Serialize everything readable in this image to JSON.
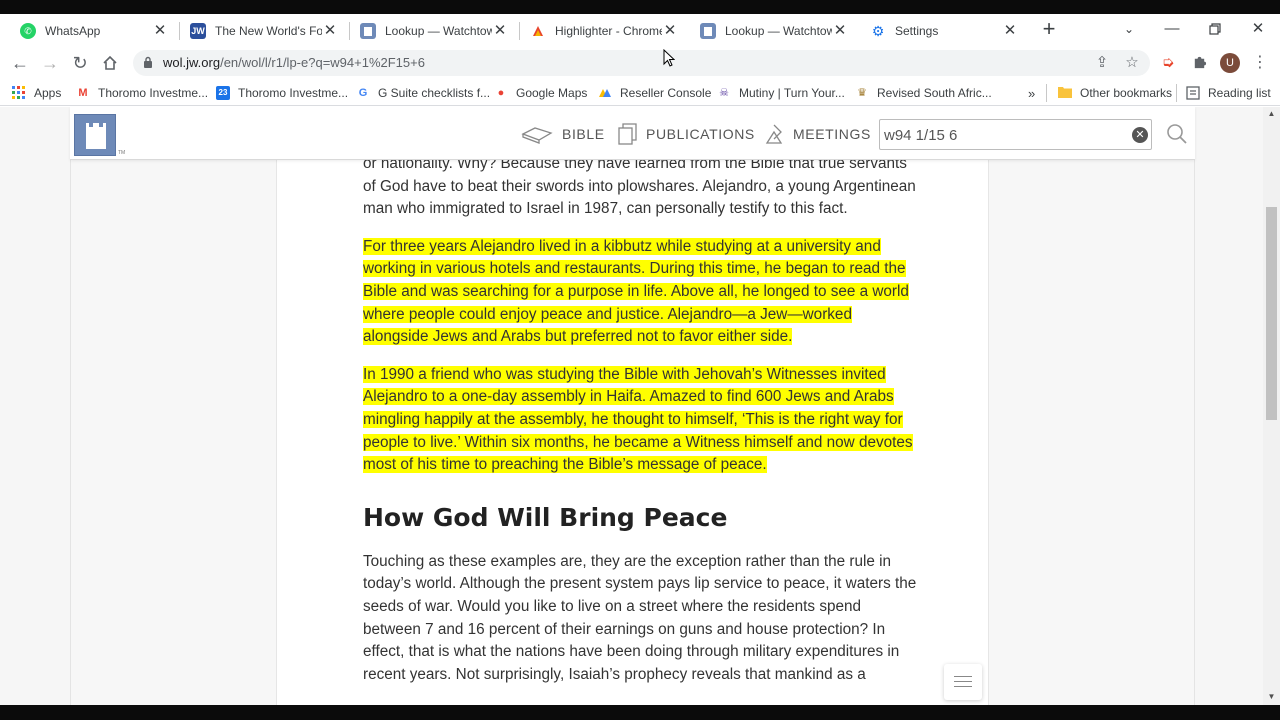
{
  "browser": {
    "tabs": [
      {
        "title": "WhatsApp",
        "favicon": "whatsapp-icon",
        "color": "#25d366"
      },
      {
        "title": "The New World's Foundation",
        "favicon": "jw-icon",
        "color": "#2b4f9c"
      },
      {
        "title": "Lookup — Watchtower",
        "favicon": "watchtower-icon",
        "color": "#6e8ab8"
      },
      {
        "title": "Highlighter - Chrome",
        "favicon": "highlighter-icon",
        "color": "#e8452c"
      },
      {
        "title": "Lookup — Watchtower",
        "favicon": "watchtower-icon",
        "color": "#6e8ab8"
      },
      {
        "title": "Settings",
        "favicon": "gear-icon",
        "color": "#1a73e8"
      }
    ],
    "active_tab": 4,
    "url_host": "wol.jw.org",
    "url_rest": "/en/wol/l/r1/lp-e?q=w94+1%2F15+6",
    "bookmarks": [
      {
        "label": "Apps",
        "icon": "apps-grid-icon"
      },
      {
        "label": "Thoromo Investme...",
        "icon": "gmail-icon"
      },
      {
        "label": "Thoromo Investme...",
        "icon": "calendar-icon"
      },
      {
        "label": "G Suite checklists f...",
        "icon": "google-icon"
      },
      {
        "label": "Google Maps",
        "icon": "maps-pin-icon"
      },
      {
        "label": "Reseller Console",
        "icon": "reseller-icon"
      },
      {
        "label": "Mutiny | Turn Your...",
        "icon": "mutiny-icon"
      },
      {
        "label": "Revised South Afric...",
        "icon": "coat-of-arms-icon"
      }
    ],
    "overflow": "»",
    "other_bookmarks": "Other bookmarks",
    "reading_list": "Reading list",
    "profile_initial": "U"
  },
  "wol": {
    "nav": [
      {
        "label": "BIBLE",
        "icon": "bible-icon"
      },
      {
        "label": "PUBLICATIONS",
        "icon": "publications-icon"
      },
      {
        "label": "MEETINGS",
        "icon": "meetings-icon"
      }
    ],
    "search_value": "w94 1/15 6",
    "logo_tm": "TM"
  },
  "article": {
    "p1": "or nationality. Why? Because they have learned from the Bible that true servants of God have to beat their swords into plowshares. Alejandro, a young Argentinean man who immigrated to Israel in 1987, can personally testify to this fact.",
    "p2": "For three years Alejandro lived in a kibbutz while studying at a university and working in various hotels and restaurants. During this time, he began to read the Bible and was searching for a purpose in life. Above all, he longed to see a world where people could enjoy peace and justice. Alejandro—a Jew—worked alongside Jews and Arabs but preferred not to favor either side.",
    "p3": "In 1990 a friend who was studying the Bible with Jehovah’s Witnesses invited Alejandro to a one-day assembly in Haifa. Amazed to find 600 Jews and Arabs mingling happily at the assembly, he thought to himself, ‘This is the right way for people to live.’ Within six months, he became a Witness himself and now devotes most of his time to preaching the Bible’s message of peace.",
    "heading": "How God Will Bring Peace",
    "p4": "Touching as these examples are, they are the exception rather than the rule in today’s world. Although the present system pays lip service to peace, it waters the seeds of war. Would you like to live on a street where the residents spend between 7 and 16 percent of their earnings on guns and house protection? In effect, that is what the nations have been doing through military expenditures in recent years. Not surprisingly, Isaiah’s prophecy reveals that mankind as a",
    "highlight_color": "#ffff00"
  }
}
